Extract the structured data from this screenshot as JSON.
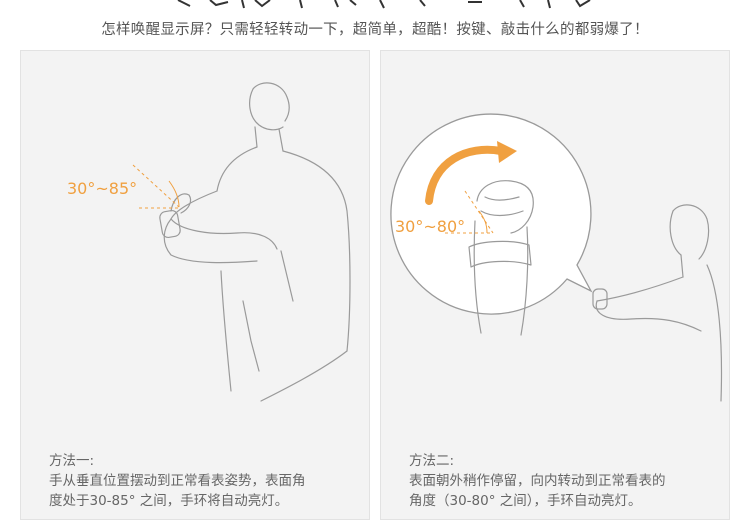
{
  "subtitle": "怎样唤醒显示屏？只需轻轻转动一下，超简单，超酷！按键、敲击什么的都弱爆了！",
  "panels": [
    {
      "angle_label": "30°~85°",
      "method_title": "方法一:",
      "method_line1": "手从垂直位置摆动到正常看表姿势，表面角",
      "method_line2": "度处于30-85° 之间，手环将自动亮灯。"
    },
    {
      "angle_label": "30°~80°",
      "method_title": "方法二:",
      "method_line1": "表面朝外稍作停留，向内转动到正常看表的",
      "method_line2": "角度（30-80° 之间），手环自动亮灯。"
    }
  ],
  "colors": {
    "accent_orange": "#f0a040",
    "panel_bg": "#f3f3f3",
    "line_art": "#9a9a9a"
  }
}
